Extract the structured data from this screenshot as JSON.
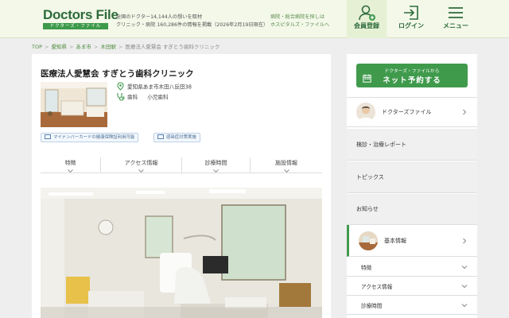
{
  "header": {
    "logo_text": "Doctors File",
    "logo_subtext": "ドクターズ・ファイル",
    "tagline_line1": "全国のドクター14,144人の想いを取材",
    "tagline_line2": "クリニック・病院 160,286件の情報を掲載（2026年2月19日現在）",
    "hospital_link_line1": "病院・総合病院を探しは",
    "hospital_link_line2": "ホスピタルズ・ファイルへ",
    "register_label": "会員登録",
    "login_label": "ログイン",
    "menu_label": "メニュー"
  },
  "breadcrumb": {
    "items": [
      "TOP",
      "愛知県",
      "あま市",
      "木田駅",
      "医療法人愛慧会 すぎとう歯科クリニック"
    ],
    "separator": ">"
  },
  "clinic": {
    "title": "医療法人愛慧会 すぎとう歯科クリニック",
    "address": "愛知県あま市木田八反田38",
    "departments": [
      "歯科",
      "小児歯科"
    ]
  },
  "badges": {
    "mynumber": "マイナンバーカードの健康保険証利用可能",
    "infection": "感染症対策実施"
  },
  "tabs": [
    "特徴",
    "アクセス情報",
    "診療時間",
    "施設情報"
  ],
  "sidebar": {
    "reserve_small": "ドクターズ・ファイルから",
    "reserve_big": "ネット予約する",
    "doctors_file": "ドクターズファイル",
    "checkup_report": "検診・治療レポート",
    "topics": "トピックス",
    "notices": "お知らせ",
    "basic_info": "基本情報",
    "sub_items": [
      "特徴",
      "アクセス情報",
      "診療時間"
    ]
  },
  "colors": {
    "brand_green": "#3f9a4c",
    "header_bg": "#f3f8e9",
    "badge_blue": "#4a6b91"
  }
}
